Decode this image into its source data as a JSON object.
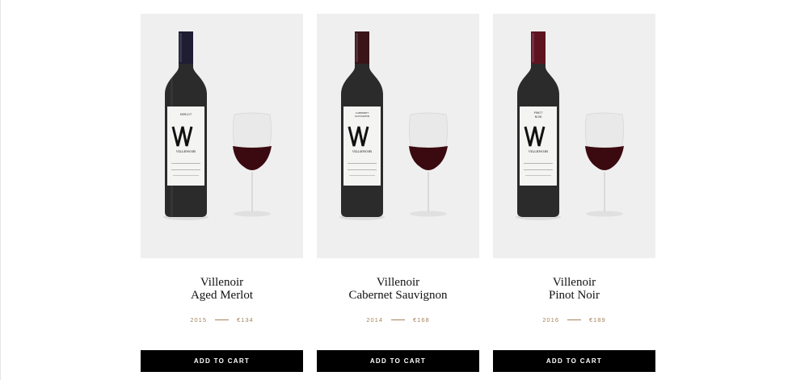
{
  "products": [
    {
      "brand": "Villenoir",
      "name": "Aged Merlot",
      "year": "2015",
      "price": "€134",
      "cta": "ADD TO CART",
      "capsule_color": "#1e1d33",
      "label_variant": "MERLOT"
    },
    {
      "brand": "Villenoir",
      "name": "Cabernet Sauvignon",
      "year": "2014",
      "price": "€168",
      "cta": "ADD TO CART",
      "capsule_color": "#3a1418",
      "label_variant": "CABERNET SAUVIGNON"
    },
    {
      "brand": "Villenoir",
      "name": "Pinot Noir",
      "year": "2016",
      "price": "€189",
      "cta": "ADD TO CART",
      "capsule_color": "#5e1420",
      "label_variant": "PINOT NOIR"
    }
  ],
  "colors": {
    "accent_gold": "#a5855a",
    "image_bg": "#efefef",
    "button_bg": "#000000",
    "wine": "#3b0a10"
  }
}
